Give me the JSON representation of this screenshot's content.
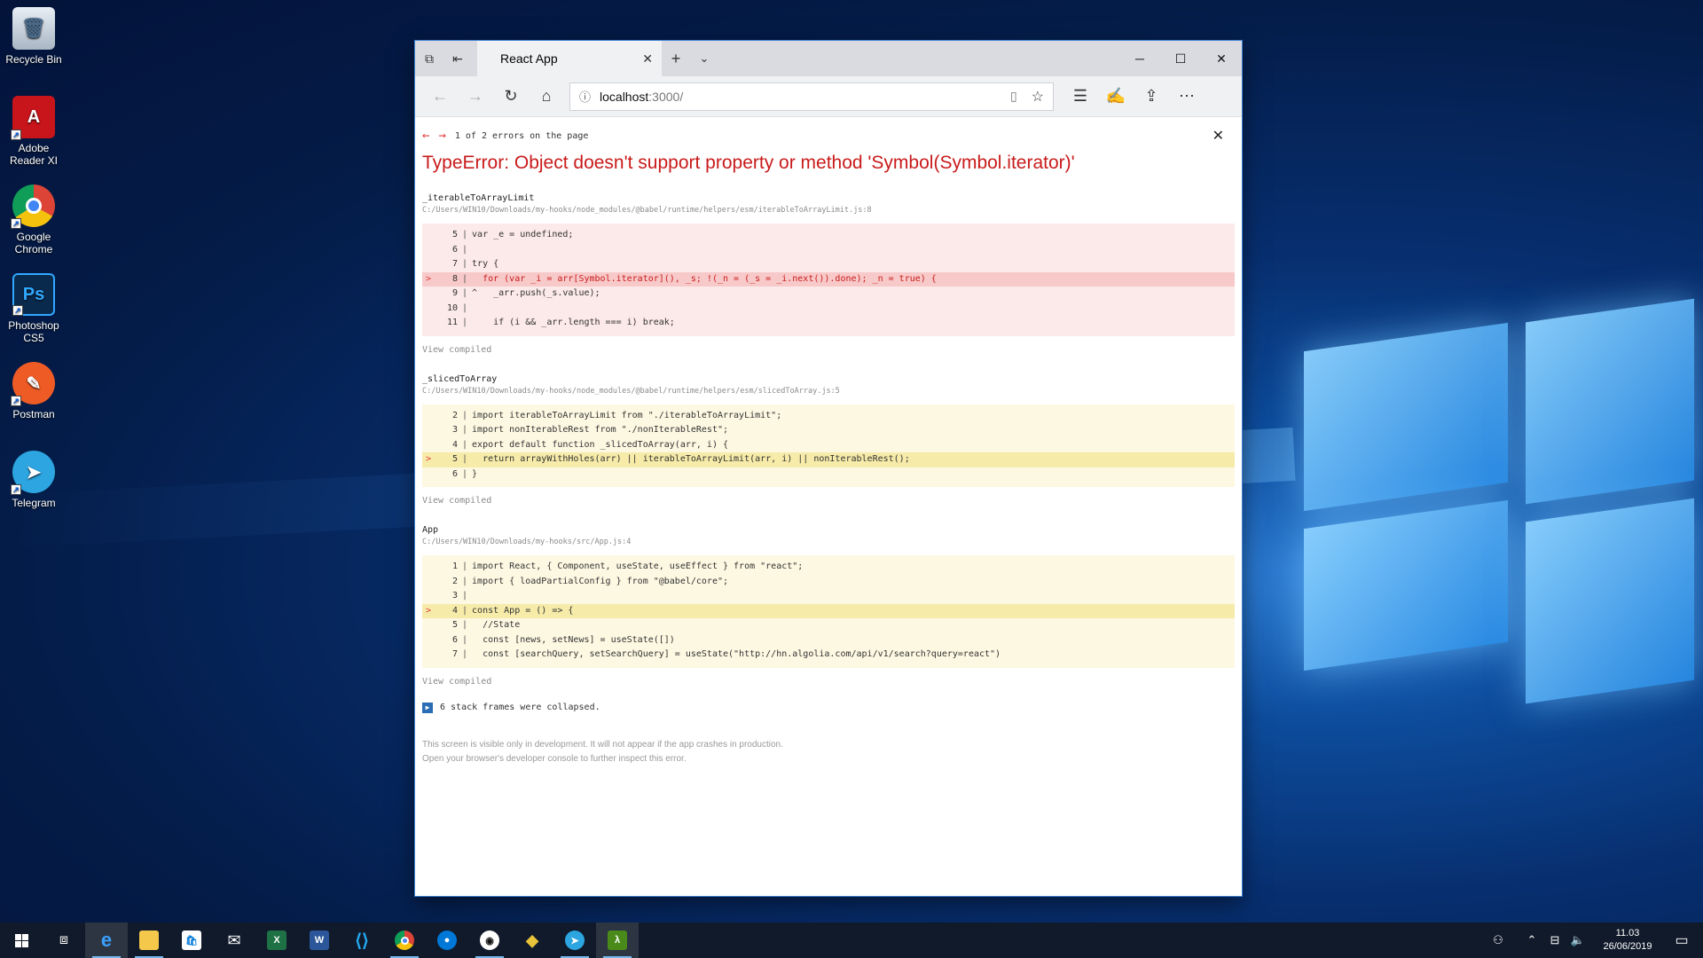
{
  "desktop": {
    "icons": [
      {
        "label": "Recycle Bin",
        "icon": "recycle-bin-icon"
      },
      {
        "label": "Adobe Reader XI",
        "icon": "adobe-reader-icon"
      },
      {
        "label": "Google Chrome",
        "icon": "chrome-icon"
      },
      {
        "label": "Photoshop CS5",
        "icon": "photoshop-icon"
      },
      {
        "label": "Postman",
        "icon": "postman-icon"
      },
      {
        "label": "Telegram",
        "icon": "telegram-icon"
      }
    ]
  },
  "browser": {
    "tab_title": "React App",
    "url_host": "localhost",
    "url_path": ":3000/"
  },
  "error": {
    "nav_text": "1 of 2 errors on the page",
    "title": "TypeError: Object doesn't support property or method 'Symbol(Symbol.iterator)'",
    "frames": [
      {
        "name": "_iterableToArrayLimit",
        "file": "C:/Users/WIN10/Downloads/my-hooks/node_modules/@babel/runtime/helpers/esm/iterableToArrayLimit.js:8",
        "lines": [
          {
            "no": "5",
            "text": "var _e = undefined;"
          },
          {
            "no": "6",
            "text": ""
          },
          {
            "no": "7",
            "text": "try {"
          },
          {
            "no": "8",
            "text": "  for (var _i = arr[Symbol.iterator](), _s; !(_n = (_s = _i.next()).done); _n = true) {"
          },
          {
            "no": "9",
            "text": "^   _arr.push(_s.value);"
          },
          {
            "no": "10",
            "text": ""
          },
          {
            "no": "11",
            "text": "    if (i && _arr.length === i) break;"
          }
        ],
        "view_compiled": "View compiled"
      },
      {
        "name": "_slicedToArray",
        "file": "C:/Users/WIN10/Downloads/my-hooks/node_modules/@babel/runtime/helpers/esm/slicedToArray.js:5",
        "lines": [
          {
            "no": "2",
            "text": "import iterableToArrayLimit from \"./iterableToArrayLimit\";"
          },
          {
            "no": "3",
            "text": "import nonIterableRest from \"./nonIterableRest\";"
          },
          {
            "no": "4",
            "text": "export default function _slicedToArray(arr, i) {"
          },
          {
            "no": "5",
            "text": "  return arrayWithHoles(arr) || iterableToArrayLimit(arr, i) || nonIterableRest();"
          },
          {
            "no": "6",
            "text": "}"
          }
        ],
        "view_compiled": "View compiled"
      },
      {
        "name": "App",
        "file": "C:/Users/WIN10/Downloads/my-hooks/src/App.js:4",
        "lines": [
          {
            "no": "1",
            "text": "import React, { Component, useState, useEffect } from \"react\";"
          },
          {
            "no": "2",
            "text": "import { loadPartialConfig } from \"@babel/core\";"
          },
          {
            "no": "3",
            "text": ""
          },
          {
            "no": "4",
            "text": "const App = () => {"
          },
          {
            "no": "5",
            "text": "  //State"
          },
          {
            "no": "6",
            "text": "  const [news, setNews] = useState([])"
          },
          {
            "no": "7",
            "text": "  const [searchQuery, setSearchQuery] = useState(\"http://hn.algolia.com/api/v1/search?query=react\")"
          }
        ],
        "view_compiled": "View compiled"
      }
    ],
    "collapsed_text": "6 stack frames were collapsed.",
    "footer_line1": "This screen is visible only in development. It will not appear if the app crashes in production.",
    "footer_line2": "Open your browser's developer console to further inspect this error."
  },
  "taskbar": {
    "apps": [
      "start",
      "task-view",
      "edge",
      "file-explorer",
      "store",
      "mail",
      "excel",
      "word",
      "vscode",
      "chrome",
      "maps",
      "github-desktop",
      "git-kraken",
      "telegram",
      "sublime"
    ],
    "time": "11.03",
    "date": "26/06/2019"
  },
  "colors": {
    "error_red": "#c91b1b",
    "red_bg": "#fce9e9",
    "yellow_bg": "#fdf8e2",
    "taskbar": "#101a2a"
  }
}
